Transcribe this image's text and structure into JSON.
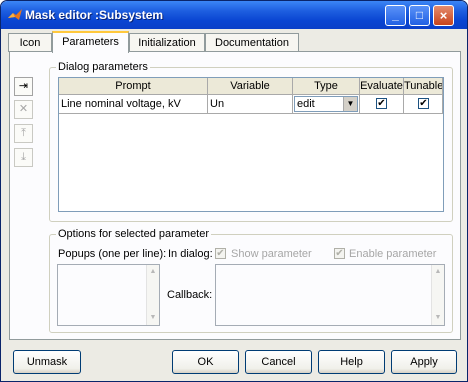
{
  "window": {
    "title": "Mask editor :Subsystem",
    "minimize_glyph": "_",
    "maximize_glyph": "□",
    "close_glyph": "×"
  },
  "tabs": [
    {
      "label": "Icon"
    },
    {
      "label": "Parameters"
    },
    {
      "label": "Initialization"
    },
    {
      "label": "Documentation"
    }
  ],
  "dialog_parameters": {
    "legend": "Dialog parameters",
    "side_buttons": [
      {
        "icon": "add-parameter-icon",
        "glyph": "⇥"
      },
      {
        "icon": "delete-icon",
        "glyph": "✕"
      },
      {
        "icon": "move-up-icon",
        "glyph": "⤒"
      },
      {
        "icon": "move-down-icon",
        "glyph": "⤓"
      }
    ],
    "columns": [
      "Prompt",
      "Variable",
      "Type",
      "Evaluate",
      "Tunable"
    ],
    "rows": [
      {
        "prompt": "Line nominal voltage, kV",
        "variable": "Un",
        "type": "edit",
        "evaluate": true,
        "tunable": true
      }
    ]
  },
  "options": {
    "legend": "Options for selected parameter",
    "popups_label": "Popups (one per line):",
    "in_dialog_label": "In dialog:",
    "show_parameter_label": "Show parameter",
    "show_parameter_checked": true,
    "enable_parameter_label": "Enable parameter",
    "enable_parameter_checked": true,
    "callback_label": "Callback:"
  },
  "buttons": {
    "unmask": "Unmask",
    "ok": "OK",
    "cancel": "Cancel",
    "help": "Help",
    "apply": "Apply"
  },
  "glyphs": {
    "check": "✔",
    "combo_arrow": "▼",
    "scroll_up": "▲",
    "scroll_down": "▼"
  }
}
